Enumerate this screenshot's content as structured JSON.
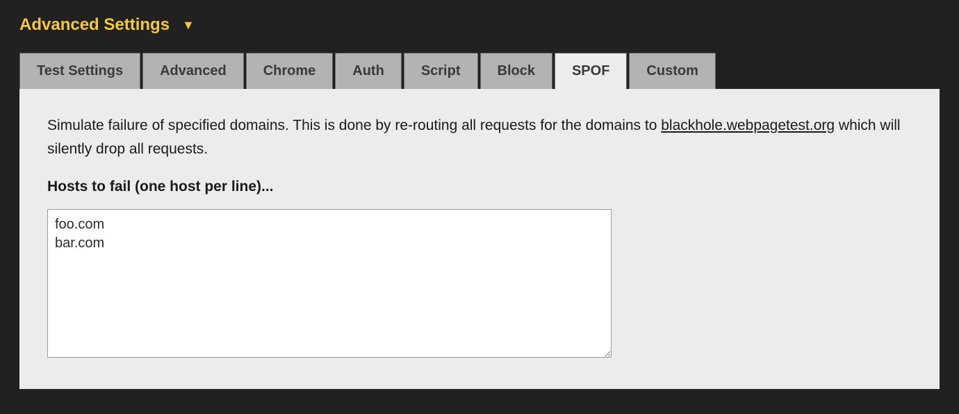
{
  "header": {
    "title": "Advanced Settings"
  },
  "tabs": {
    "items": [
      {
        "label": "Test Settings",
        "active": false
      },
      {
        "label": "Advanced",
        "active": false
      },
      {
        "label": "Chrome",
        "active": false
      },
      {
        "label": "Auth",
        "active": false
      },
      {
        "label": "Script",
        "active": false
      },
      {
        "label": "Block",
        "active": false
      },
      {
        "label": "SPOF",
        "active": true
      },
      {
        "label": "Custom",
        "active": false
      }
    ]
  },
  "spof_panel": {
    "desc_part1": "Simulate failure of specified domains. This is done by re-routing all requests for the domains to ",
    "blackhole_link": "blackhole.webpagetest.org",
    "desc_part2": " which will silently drop all requests.",
    "hosts_label": "Hosts to fail (one host per line)...",
    "hosts_value": "foo.com\nbar.com"
  }
}
